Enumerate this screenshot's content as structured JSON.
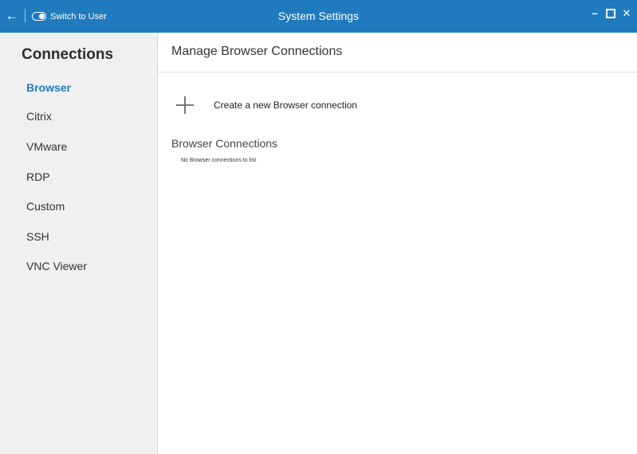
{
  "titlebar": {
    "back_icon": "arrow-left-icon",
    "switch_label": "Switch to User",
    "title": "System Settings",
    "minimize": "–",
    "close": "✕"
  },
  "sidebar": {
    "heading": "Connections",
    "items": [
      {
        "label": "Browser",
        "active": true
      },
      {
        "label": "Citrix"
      },
      {
        "label": "VMware"
      },
      {
        "label": "RDP"
      },
      {
        "label": "Custom"
      },
      {
        "label": "SSH"
      },
      {
        "label": "VNC Viewer"
      }
    ]
  },
  "main": {
    "title": "Manage Browser Connections",
    "create_label": "Create a new Browser connection",
    "section_title": "Browser Connections",
    "empty_message": "No Browser connections to list"
  },
  "colors": {
    "titlebar_bg": "#1f7bbd",
    "accent": "#1f7bbd",
    "sidebar_bg": "#f0f0f0"
  }
}
